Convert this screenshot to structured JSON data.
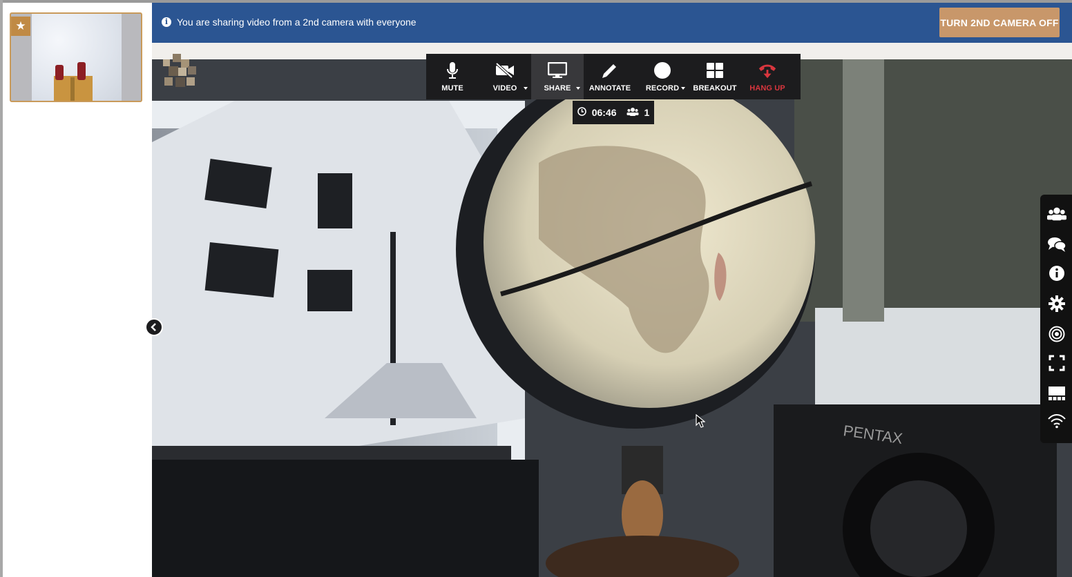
{
  "banner": {
    "message": "You are sharing video from a 2nd camera with everyone",
    "button_label": "TURN 2ND CAMERA OFF"
  },
  "toolbar": {
    "items": [
      {
        "label": "MUTE",
        "icon": "microphone-icon"
      },
      {
        "label": "VIDEO",
        "icon": "video-off-icon",
        "has_dropdown": true
      },
      {
        "label": "SHARE",
        "icon": "monitor-icon",
        "has_dropdown": true,
        "active": true
      },
      {
        "label": "ANNOTATE",
        "icon": "pencil-icon"
      },
      {
        "label": "RECORD",
        "icon": "record-icon",
        "has_dropdown": true
      },
      {
        "label": "BREAKOUT",
        "icon": "grid-icon"
      },
      {
        "label": "HANG UP",
        "icon": "phone-hangup-icon",
        "color": "#d9363e"
      }
    ]
  },
  "status": {
    "timer": "06:46",
    "participants": "1"
  },
  "right_rail": {
    "icons": [
      "participants-icon",
      "chat-icon",
      "info-icon",
      "settings-icon",
      "target-icon",
      "fullscreen-icon",
      "layout-icon",
      "wifi-icon"
    ]
  },
  "colors": {
    "banner_bg": "#2b5592",
    "banner_button": "#c8976a",
    "toolbar_bg": "#1c1c1e",
    "hangup": "#d9363e",
    "thumb_border": "#c99a5a"
  }
}
